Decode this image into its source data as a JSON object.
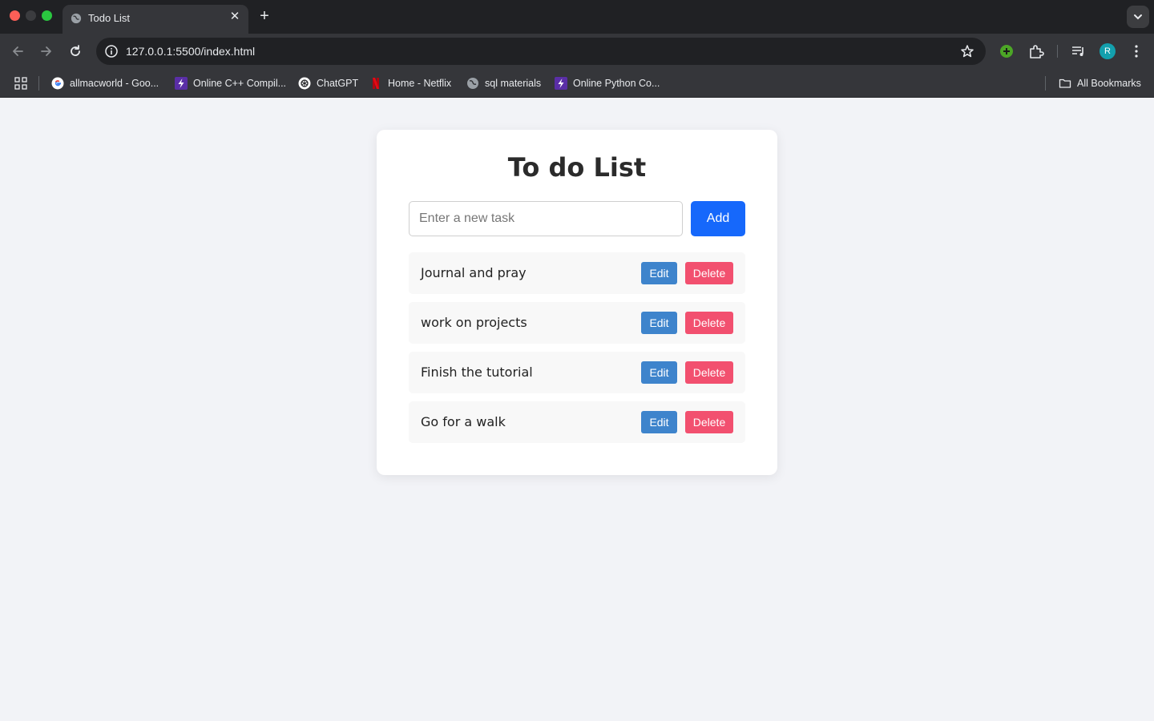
{
  "browser": {
    "tab": {
      "title": "Todo List",
      "close": "✕"
    },
    "new_tab": "+",
    "url": "127.0.0.1:5500/index.html",
    "avatar_initial": "R",
    "bookmarks": [
      {
        "label": "allmacworld - Goo...",
        "icon": "google-icon"
      },
      {
        "label": "Online C++ Compil...",
        "icon": "bolt-icon"
      },
      {
        "label": "ChatGPT",
        "icon": "chatgpt-icon"
      },
      {
        "label": "Home - Netflix",
        "icon": "netflix-icon"
      },
      {
        "label": "sql materials",
        "icon": "globe-icon"
      },
      {
        "label": "Online Python Co...",
        "icon": "bolt-icon"
      }
    ],
    "all_bookmarks": "All Bookmarks"
  },
  "app": {
    "title": "To do List",
    "input_placeholder": "Enter a new task",
    "input_value": "",
    "add_label": "Add",
    "tasks": [
      {
        "text": "Journal and pray",
        "edit_label": "Edit",
        "delete_label": "Delete"
      },
      {
        "text": "work on projects",
        "edit_label": "Edit",
        "delete_label": "Delete"
      },
      {
        "text": "Finish the tutorial",
        "edit_label": "Edit",
        "delete_label": "Delete"
      },
      {
        "text": "Go for a walk",
        "edit_label": "Edit",
        "delete_label": "Delete"
      }
    ]
  },
  "colors": {
    "page_bg": "#f2f3f7",
    "add_button": "#1668fb",
    "edit_button": "#3e84cc",
    "delete_button": "#f2506f"
  }
}
